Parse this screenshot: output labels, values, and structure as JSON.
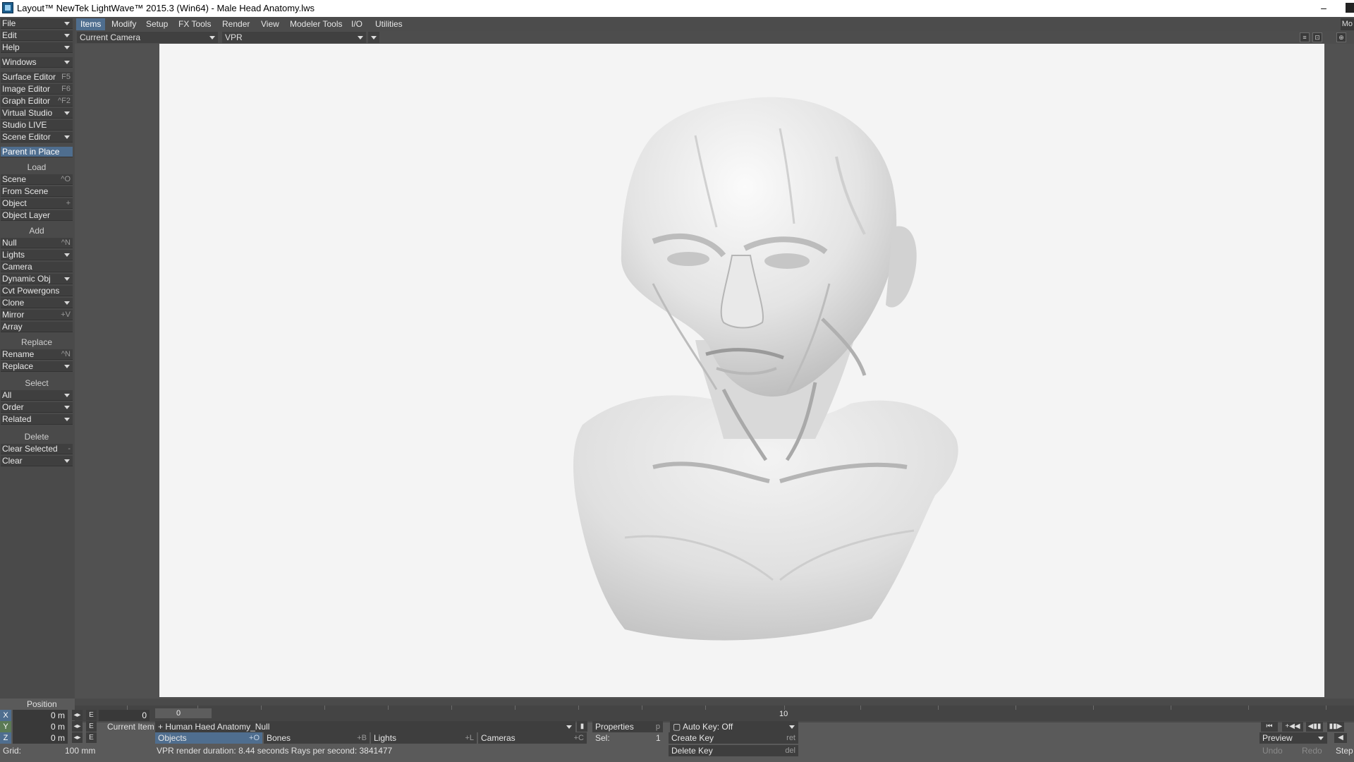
{
  "window": {
    "title": "Layout™ NewTek LightWave™ 2015.3 (Win64) - Male Head Anatomy.lws",
    "minimize": "–"
  },
  "tabs": [
    "Items",
    "Modify",
    "Setup",
    "FX Tools",
    "Render",
    "View",
    "Modeler Tools",
    "I/O",
    "Utilities"
  ],
  "tabs_corner": "Mo",
  "sidebar": {
    "menus": [
      {
        "label": "File"
      },
      {
        "label": "Edit"
      },
      {
        "label": "Help"
      }
    ],
    "windows": "Windows",
    "editors": [
      {
        "label": "Surface Editor",
        "hotkey": "F5"
      },
      {
        "label": "Image Editor",
        "hotkey": "F6"
      },
      {
        "label": "Graph Editor",
        "hotkey": "^F2"
      },
      {
        "label": "Virtual Studio",
        "hotkey": ""
      },
      {
        "label": "Studio LIVE",
        "hotkey": ""
      },
      {
        "label": "Scene Editor",
        "hotkey": ""
      }
    ],
    "parent_in_place": "Parent in Place",
    "load_header": "Load",
    "load": [
      {
        "label": "Scene",
        "hotkey": "^O"
      },
      {
        "label": "From Scene",
        "hotkey": ""
      },
      {
        "label": "Object",
        "hotkey": "+"
      },
      {
        "label": "Object Layer",
        "hotkey": ""
      }
    ],
    "add_header": "Add",
    "add": [
      {
        "label": "Null",
        "hotkey": "^N"
      },
      {
        "label": "Lights",
        "hotkey": ""
      },
      {
        "label": "Camera",
        "hotkey": ""
      },
      {
        "label": "Dynamic Obj",
        "hotkey": ""
      },
      {
        "label": "Cvt Powergons",
        "hotkey": ""
      },
      {
        "label": "Clone",
        "hotkey": ""
      },
      {
        "label": "Mirror",
        "hotkey": "+V"
      },
      {
        "label": "Array",
        "hotkey": ""
      }
    ],
    "replace_header": "Replace",
    "replace": [
      {
        "label": "Rename",
        "hotkey": "^N"
      },
      {
        "label": "Replace",
        "hotkey": ""
      }
    ],
    "select_header": "Select",
    "select": [
      {
        "label": "All"
      },
      {
        "label": "Order"
      },
      {
        "label": "Related"
      }
    ],
    "delete_header": "Delete",
    "delete": [
      {
        "label": "Clear Selected",
        "hotkey": "-"
      },
      {
        "label": "Clear",
        "hotkey": ""
      }
    ]
  },
  "viewport": {
    "camera": "Current Camera",
    "render_mode": "VPR"
  },
  "timeline": {
    "start": "0",
    "current_frame": "0",
    "mark_10": "10"
  },
  "bottom": {
    "position_label": "Position",
    "x_label": "X",
    "y_label": "Y",
    "z_label": "Z",
    "x_value": "0 m",
    "y_value": "0 m",
    "z_value": "0 m",
    "e_label": "E",
    "frame_value": "0",
    "current_item_label": "Current Item",
    "current_item": "Human Haed Anatomy_Null",
    "properties": "Properties",
    "properties_hotkey": "p",
    "autokey": "Auto Key: Off",
    "objects": "Objects",
    "objects_hotkey": "+O",
    "bones": "Bones",
    "bones_hotkey": "+B",
    "lights": "Lights",
    "lights_hotkey": "+L",
    "cameras": "Cameras",
    "cameras_hotkey": "+C",
    "sel_label": "Sel:",
    "sel_value": "1",
    "create_key": "Create Key",
    "create_key_hotkey": "ret",
    "delete_key": "Delete Key",
    "delete_key_hotkey": "del",
    "grid_label": "Grid:",
    "grid_value": "100 mm",
    "status": "VPR render duration: 8.44 seconds  Rays per second: 3841477",
    "preview": "Preview",
    "undo": "Undo",
    "redo": "Redo",
    "step": "Step"
  }
}
